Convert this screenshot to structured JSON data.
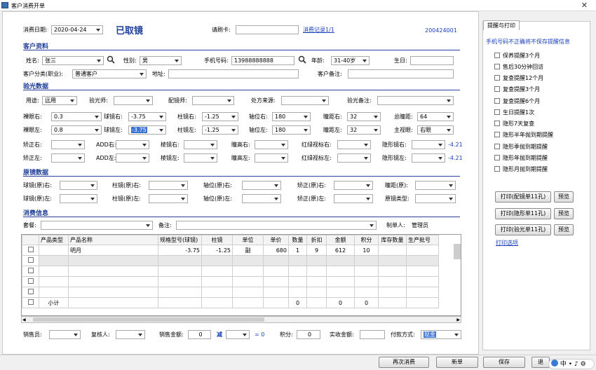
{
  "window": {
    "title": "客户消费开单"
  },
  "top": {
    "date_label": "消费日期:",
    "date_value": "2020-04-24",
    "status": "已取镜",
    "card_label": "请刷卡:",
    "card_value": "",
    "history_link": "消费记录1/1",
    "order_no": "200424001"
  },
  "sections": {
    "customer": "客户资料",
    "optometry": "验光数据",
    "original": "原镜数据",
    "consume": "消费信息"
  },
  "customer": {
    "name_label": "姓名:",
    "name_value": "张三",
    "gender_label": "性别:",
    "gender_value": "男",
    "phone_label": "手机号码:",
    "phone_value": "13988888888",
    "age_label": "年龄:",
    "age_value": "31-40岁",
    "birthday_label": "生日:",
    "birthday_value": "",
    "category_label": "客户分类(职业):",
    "category_value": "普通客户",
    "address_label": "地址:",
    "address_value": "",
    "remark_label": "客户备注:",
    "remark_value": ""
  },
  "optometry": {
    "use_label": "用途:",
    "use_value": "远用",
    "optometrist_label": "验光师:",
    "optometrist_value": "",
    "fitter_label": "配镜师:",
    "fitter_value": "",
    "rx_source_label": "处方来源:",
    "rx_source_value": "",
    "note_label": "验光备注:",
    "note_value": "",
    "ua_r_label": "裸眼右:",
    "ua_r_value": "0.3",
    "sph_r_label": "球镜右:",
    "sph_r_value": "-3.75",
    "cyl_r_label": "柱镜右:",
    "cyl_r_value": "-1.25",
    "axis_r_label": "轴位右:",
    "axis_r_value": "180",
    "pd_r_label": "瞳距右:",
    "pd_r_value": "32",
    "total_pd_label": "总瞳距:",
    "total_pd_value": "64",
    "ua_l_label": "裸眼左:",
    "ua_l_value": "0.8",
    "sph_l_label": "球镜左:",
    "sph_l_value": "-3.75",
    "cyl_l_label": "柱镜左:",
    "cyl_l_value": "-1.25",
    "axis_l_label": "轴位左:",
    "axis_l_value": "180",
    "pd_l_label": "瞳距左:",
    "pd_l_value": "32",
    "dominant_label": "主视眼:",
    "dominant_value": "右眼",
    "va_r_label": "矫正右:",
    "add_r_label": "ADD右:",
    "prism_r_label": "棱镜右:",
    "ph_r_label": "瞳高右:",
    "rg_r_label": "红绿视标右:",
    "cl_r_label": "隐形镜右:",
    "cl_r_value": "-4.21",
    "va_l_label": "矫正左:",
    "add_l_label": "ADD左:",
    "prism_l_label": "棱镜左:",
    "ph_l_label": "瞳高左:",
    "rg_l_label": "红绿视标左:",
    "cl_l_label": "隐形镜左:",
    "cl_l_value": "-4.21"
  },
  "original": {
    "sph_r_label": "球镜(原)右:",
    "cyl_r_label": "柱镜(原)右:",
    "axis_r_label": "轴位(原)右:",
    "va_r_label": "矫正(原)右:",
    "pd_label": "瞳距(原):",
    "sph_l_label": "球镜(原)左:",
    "cyl_l_label": "柱镜(原)左:",
    "axis_l_label": "轴位(原)左:",
    "va_l_label": "矫正(原)左:",
    "type_label": "原镜类型:"
  },
  "consume": {
    "package_label": "套餐:",
    "remark_label": "备注:",
    "maker_label": "制单人:",
    "maker_value": "管理员",
    "columns": [
      "",
      "产品类型",
      "产品名称",
      "规格型号(球镜)",
      "柱镜",
      "单位",
      "单价",
      "数量",
      "折扣",
      "金额",
      "积分",
      "库存数量",
      "生产批号"
    ],
    "rows": [
      [
        "",
        "",
        "明月",
        "-3.75",
        "-1.25",
        "副",
        "680",
        "1",
        "9",
        "612",
        "10",
        "",
        ""
      ],
      [
        "",
        "",
        "",
        "",
        "",
        "",
        "",
        "",
        "",
        "",
        "",
        "",
        ""
      ],
      [
        "",
        "",
        "",
        "",
        "",
        "",
        "",
        "",
        "",
        "",
        "",
        "",
        ""
      ],
      [
        "",
        "",
        "",
        "",
        "",
        "",
        "",
        "",
        "",
        "",
        "",
        "",
        ""
      ],
      [
        "",
        "",
        "",
        "",
        "",
        "",
        "",
        "",
        "",
        "",
        "",
        "",
        ""
      ]
    ],
    "subtotal": {
      "label": "小计",
      "qty": "0",
      "amount": "0",
      "points": "0"
    }
  },
  "bottom": {
    "seller_label": "销售员:",
    "reviewer_label": "复核人:",
    "sales_amount_label": "销售金额:",
    "sales_amount_value": "0",
    "minus_label": "减",
    "equals": "= 0",
    "points_label": "积分:",
    "points_value": "0",
    "actual_label": "实收金额:",
    "actual_value": "",
    "pay_label": "付款方式:",
    "pay_value": "现金"
  },
  "right_panel": {
    "tab": "提醒与打印",
    "warning": "手机号码不正确将不保存提醒信息",
    "reminders": [
      "保养提醒3个月",
      "售后30分钟回访",
      "复查提醒12个月",
      "复查提醒3个月",
      "复查提醒6个月",
      "生日提醒1次",
      "隐形7天复查",
      "隐形半年抛到期提醒",
      "隐形季抛到期提醒",
      "隐形年抛到期提醒",
      "隐形月抛到期提醒"
    ],
    "print_buttons": [
      "打印(配镜单11孔)",
      "打印(隐形单11孔)",
      "打印(验光单11孔)"
    ],
    "preview_label": "预览",
    "print_options": "打印选项"
  },
  "actions": {
    "again": "再次消费",
    "new": "新单",
    "save": "保存",
    "exit": "退"
  },
  "tray": {
    "ime": "中"
  }
}
